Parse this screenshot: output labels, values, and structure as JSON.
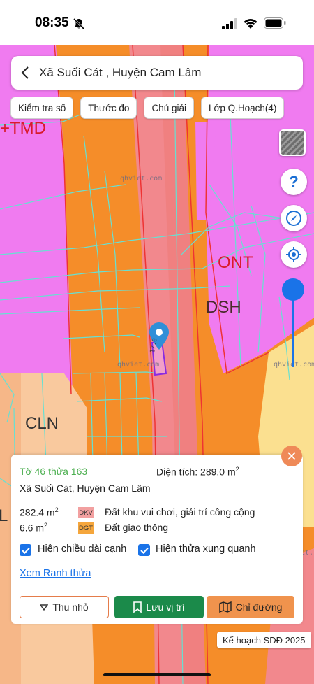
{
  "status": {
    "time": "08:35"
  },
  "header": {
    "title": "Xã Suối Cát , Huyện Cam Lâm"
  },
  "chips": [
    "Kiểm tra số",
    "Thước đo",
    "Chú giải",
    "Lớp Q.Hoạch(4)"
  ],
  "map": {
    "labels": {
      "tmd": "+TMD",
      "ont": "ONT",
      "dsh": "DSH",
      "cln": "CLN",
      "left_fragment": "L"
    },
    "watermark": [
      "qhviet.com",
      "qhviet.com",
      "qhviet.com",
      "ict.c"
    ],
    "parcel_dimension": "17.0",
    "colors": {
      "orange": "#f58d29",
      "pink": "#f07bf0",
      "salmon": "#f2888d",
      "peach": "#f9c99e",
      "yellow": "#fbe090",
      "lines": "#67e0d2"
    }
  },
  "controls": {
    "help": "?"
  },
  "info": {
    "parcel": "Tờ 46 thửa 163",
    "area_label": "Diện tích: 289.0 m",
    "area_sup": "2",
    "address": "Xã Suối Cát, Huyện Cam Lâm",
    "rows": [
      {
        "value": "282.4 m",
        "sup": "2",
        "code": "DKV",
        "name": "Đất khu vui chơi, giải trí công cộng",
        "color": "#f2a0a0"
      },
      {
        "value": "6.6 m",
        "sup": "2",
        "code": "DGT",
        "name": "Đất giao thông",
        "color": "#f5a63c"
      }
    ],
    "checks": [
      "Hiện chiều dài cạnh",
      "Hiện thửa xung quanh"
    ],
    "link": "Xem Ranh thửa",
    "buttons": {
      "shrink": "Thu nhỏ",
      "save": "Lưu vị trí",
      "directions": "Chỉ đường"
    }
  },
  "plan_badge": "Kế hoạch SDĐ 2025"
}
